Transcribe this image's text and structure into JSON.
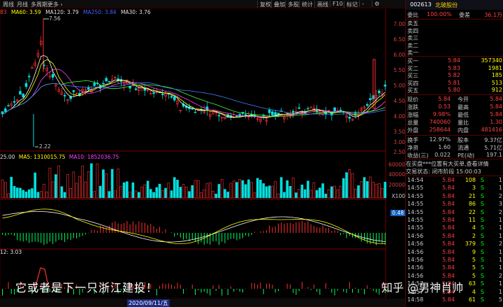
{
  "toolbar": {
    "tabs": [
      "周线",
      "月线",
      "多周期",
      "更多 ›"
    ],
    "buttons": [
      "复权",
      "叠加",
      "多股",
      "统计",
      "画线",
      "F10",
      "标记",
      "-",
      "⚙"
    ]
  },
  "ma_legend": {
    "prefix": "83",
    "ma60": "MA60: 3.59",
    "ma120": "MA120: 3.79",
    "ma250": "MA250: 3.84",
    "ma30": "MA30: 3.76"
  },
  "price_annotations": {
    "high": "7.56",
    "low": "2.22"
  },
  "price_axis": [
    "7.00",
    "6.50",
    "6.00",
    "5.50",
    "5.00",
    "4.50",
    "4.00",
    "3.50",
    "3.00",
    "2.50"
  ],
  "vol_axis": [
    "60000",
    "40000",
    "20000",
    "X100"
  ],
  "macd_axis_value": "0.48",
  "vol_legend": {
    "vol": "25.00",
    "ma5": "MA5: 1310015.75",
    "ma10": "MA10: 1852036.75"
  },
  "kdj_legend": "12: 3.03",
  "date_label": "2020/09/11/五",
  "stock": {
    "code": "002613",
    "name": "北玻股份"
  },
  "order_summary": [
    {
      "k": "委比",
      "v": "100.00%",
      "k2": "委差",
      "v2": "36.1万"
    }
  ],
  "asks": [
    {
      "label": "卖五",
      "price": "",
      "vol": ""
    },
    {
      "label": "卖四",
      "price": "",
      "vol": ""
    },
    {
      "label": "卖三",
      "price": "",
      "vol": ""
    },
    {
      "label": "卖二",
      "price": "",
      "vol": ""
    },
    {
      "label": "卖一",
      "price": "",
      "vol": ""
    }
  ],
  "bids": [
    {
      "label": "买一",
      "price": "5.84",
      "vol": "357340"
    },
    {
      "label": "买二",
      "price": "5.83",
      "vol": "1981"
    },
    {
      "label": "买三",
      "price": "5.82",
      "vol": "185"
    },
    {
      "label": "买四",
      "price": "5.81",
      "vol": "513"
    },
    {
      "label": "买五",
      "price": "5.80",
      "vol": "912"
    }
  ],
  "quote": [
    {
      "k": "现价",
      "v": "5.84",
      "k2": "今开",
      "v2": "5.84"
    },
    {
      "k": "涨跌",
      "v": "0.53",
      "k2": "最高",
      "v2": "5.84"
    },
    {
      "k": "涨幅",
      "v": "9.98%",
      "k2": "最低",
      "v2": "5.84"
    },
    {
      "k": "总量",
      "v": "740060",
      "k2": "量比",
      "v2": "1.30"
    },
    {
      "k": "外盘",
      "v": "258644",
      "k2": "内盘",
      "v2": "481416"
    }
  ],
  "fundamentals": [
    {
      "k": "换手",
      "v": "12.97%",
      "k2": "股本",
      "v2": "9.37亿"
    },
    {
      "k": "净资",
      "v": "1.60",
      "k2": "流通",
      "v2": "5.71亿"
    },
    {
      "k": "收益(三)",
      "v": "0.022",
      "k2": "PE(动)",
      "v2": "197.1"
    }
  ],
  "notice": "在买盘***位置有大买单,查看详情",
  "status": "交易状态: 闭市阶段 15:00:03",
  "trades": [
    {
      "t": "14:54",
      "p": "5.84",
      "v": "108",
      "s": "S",
      "n": "1"
    },
    {
      "t": "14:55",
      "p": "5.84",
      "v": "3",
      "s": "S",
      "n": "1"
    },
    {
      "t": "14:55",
      "p": "5.84",
      "v": "21",
      "s": "S",
      "n": "2"
    },
    {
      "t": "14:55",
      "p": "5.84",
      "v": "86",
      "s": "S",
      "n": "3"
    },
    {
      "t": "14:55",
      "p": "5.84",
      "v": "22",
      "s": "S",
      "n": "2"
    },
    {
      "t": "14:55",
      "p": "5.84",
      "v": "11",
      "s": "S",
      "n": "1"
    },
    {
      "t": "14:55",
      "p": "5.84",
      "v": "4",
      "s": "S",
      "n": "1"
    },
    {
      "t": "14:56",
      "p": "5.84",
      "v": "2",
      "s": "S",
      "n": "1"
    },
    {
      "t": "14:56",
      "p": "5.84",
      "v": "379",
      "s": "S",
      "n": "2"
    },
    {
      "t": "14:56",
      "p": "5.84",
      "v": "9",
      "s": "S",
      "n": "1"
    },
    {
      "t": "14:56",
      "p": "5.84",
      "v": "5",
      "s": "S",
      "n": "1"
    },
    {
      "t": "14:56",
      "p": "5.84",
      "v": "5",
      "s": "S",
      "n": "1"
    },
    {
      "t": "14:56",
      "p": "5.84",
      "v": "5",
      "s": "S",
      "n": "2"
    },
    {
      "t": "14:57",
      "p": "5.84",
      "v": "63",
      "s": "S",
      "n": "1"
    },
    {
      "t": "14:57",
      "p": "5.84",
      "v": "4",
      "s": "S",
      "n": "1"
    },
    {
      "t": "14:58",
      "p": "5.84",
      "v": "61",
      "s": "S",
      "n": "5"
    }
  ],
  "caption": "它或者是下一只浙江建投！",
  "watermark": "知乎 @男神肖帅"
}
